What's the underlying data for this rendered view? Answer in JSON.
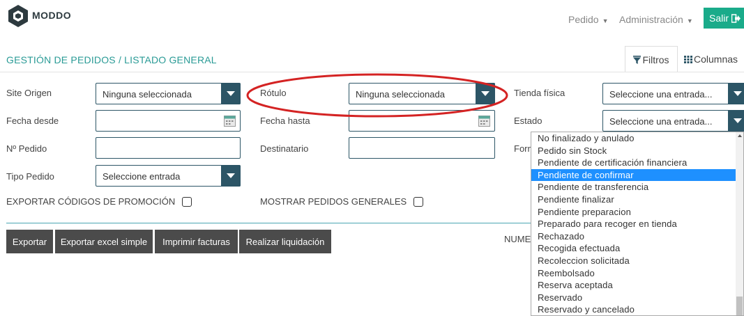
{
  "header": {
    "logo_text": "MODDO",
    "nav_pedido": "Pedido",
    "nav_admin": "Administración",
    "salir": "Salir",
    "accent_color": "#1aab8a"
  },
  "title": {
    "text": "GESTIÓN DE PEDIDOS / LISTADO GENERAL",
    "tab_filtros": "Filtros",
    "tab_columnas": "Columnas"
  },
  "form": {
    "site_origen": {
      "label": "Site Origen",
      "value": "Ninguna seleccionada"
    },
    "rotulo": {
      "label": "Rótulo",
      "value": "Ninguna seleccionada"
    },
    "tienda_fisica": {
      "label": "Tienda física",
      "value": "Seleccione una entrada..."
    },
    "fecha_desde": {
      "label": "Fecha desde",
      "value": ""
    },
    "fecha_hasta": {
      "label": "Fecha hasta",
      "value": ""
    },
    "estado": {
      "label": "Estado",
      "value": "Seleccione una entrada..."
    },
    "num_pedido": {
      "label": "Nº Pedido",
      "value": ""
    },
    "destinatario": {
      "label": "Destinatario",
      "value": ""
    },
    "forma_label": "Form",
    "tipo_pedido": {
      "label": "Tipo Pedido",
      "value": "Seleccione entrada"
    },
    "exportar_codigos": "EXPORTAR CÓDIGOS DE PROMOCIÓN",
    "mostrar_generales": "MOSTRAR PEDIDOS GENERALES"
  },
  "actions": {
    "exportar": "Exportar",
    "exportar_excel": "Exportar excel simple",
    "imprimir": "Imprimir facturas",
    "liquidacion": "Realizar liquidación",
    "numero_label": "NUME"
  },
  "estado_dropdown": {
    "selected_index": 3,
    "options": [
      "No finalizado y anulado",
      "Pedido sin Stock",
      "Pendiente de certificación financiera",
      "Pendiente de confirmar",
      "Pendiente de transferencia",
      "Pendiente finalizar",
      "Pendiente preparacion",
      "Preparado para recoger en tienda",
      "Rechazado",
      "Recogida efectuada",
      "Recoleccion solicitada",
      "Reembolsado",
      "Reserva aceptada",
      "Reservado",
      "Reservado y cancelado"
    ]
  }
}
